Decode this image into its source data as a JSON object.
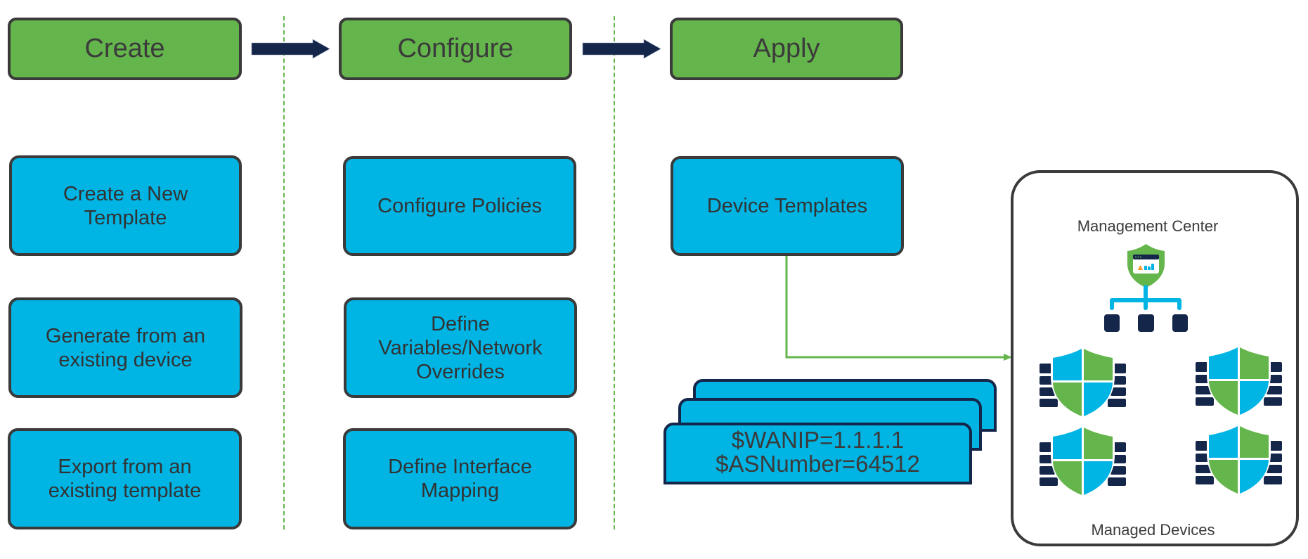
{
  "phases": [
    {
      "label": "Create"
    },
    {
      "label": "Configure"
    },
    {
      "label": "Apply"
    }
  ],
  "create_steps": [
    {
      "lines": [
        "Create a New",
        "Template"
      ]
    },
    {
      "lines": [
        "Generate from an",
        "existing device"
      ]
    },
    {
      "lines": [
        "Export from an",
        "existing template"
      ]
    }
  ],
  "configure_steps": [
    {
      "lines": [
        "Configure Policies"
      ]
    },
    {
      "lines": [
        "Define",
        "Variables/Network",
        "Overrides"
      ]
    },
    {
      "lines": [
        "Define Interface",
        "Mapping"
      ]
    }
  ],
  "apply_steps": [
    {
      "lines": [
        "Device Templates"
      ]
    }
  ],
  "variables_card": {
    "lines": [
      "$WANIP=1.1.1.1",
      "$ASNumber=64512"
    ]
  },
  "target": {
    "management_center_label": "Management Center",
    "managed_devices_label": "Managed Devices",
    "managed_device_count": 4
  },
  "icons": {
    "flow_arrow": "right-arrow-icon",
    "management_center": "management-center-shield-icon",
    "hierarchy": "hierarchy-tree-icon",
    "firewall": "firewall-shield-icon"
  },
  "colors": {
    "phase_green": "#64b54b",
    "step_blue": "#00b4e4",
    "border_dark": "#3a3a3a",
    "arrow_navy": "#14264a",
    "connector_green": "#64b54b"
  }
}
